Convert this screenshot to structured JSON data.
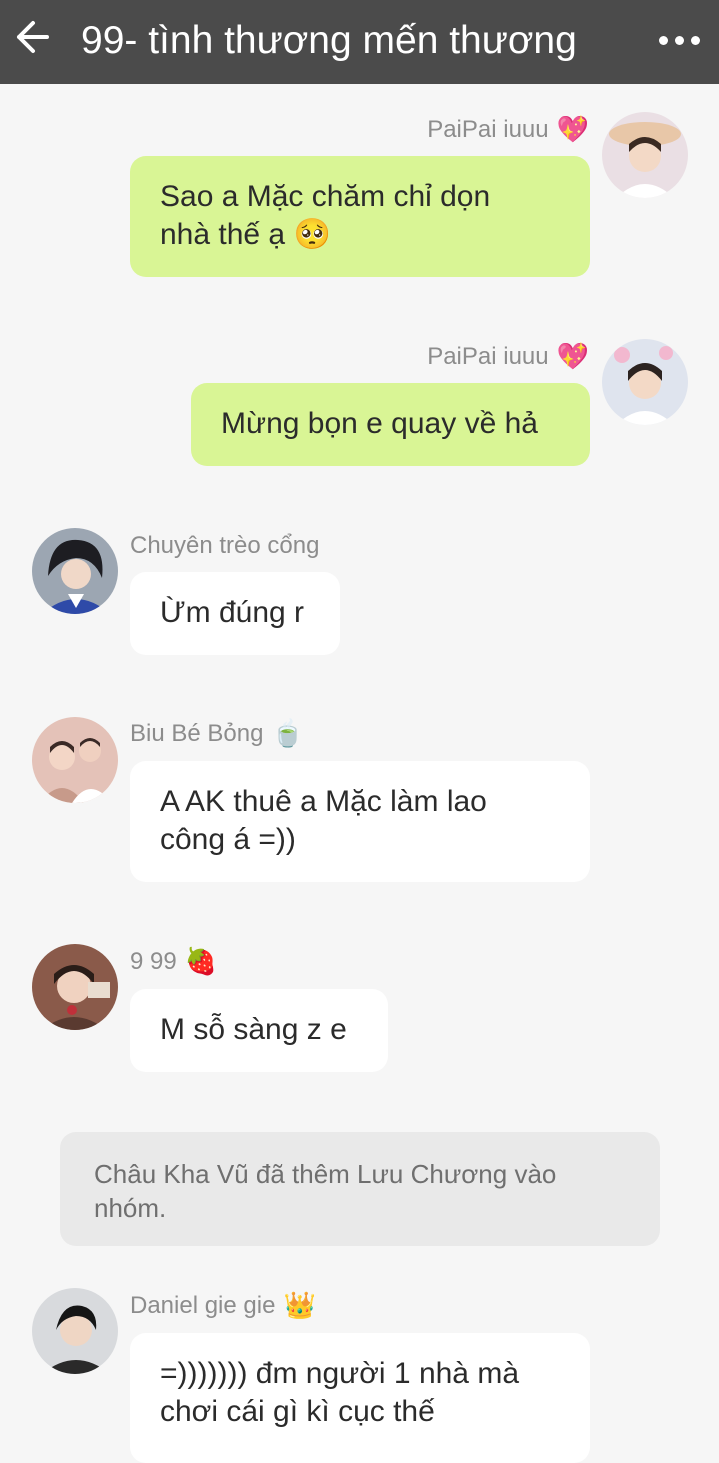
{
  "header": {
    "title": "99- tình thương mến thương",
    "back_icon": "arrow-left-icon",
    "more_icon": "more-dots-icon",
    "background": "#4b4b4b"
  },
  "colors": {
    "outgoing_bubble": "#d9f595",
    "incoming_bubble": "#ffffff",
    "background": "#f6f6f6",
    "system_notice": "#e9e9e9"
  },
  "messages": [
    {
      "direction": "out",
      "sender": "PaiPai iuuu",
      "sender_emoji": "💖",
      "text_line1": "Sao a Mặc chăm chỉ dọn",
      "text_line2": "nhà thế ạ 🥺"
    },
    {
      "direction": "out",
      "sender": "PaiPai iuuu",
      "sender_emoji": "💖",
      "text_line1": "Mừng bọn e quay về hả"
    },
    {
      "direction": "in",
      "sender": "Chuyên trèo cổng",
      "text_line1": "Ừm đúng r"
    },
    {
      "direction": "in",
      "sender": "Biu Bé Bỏng",
      "sender_emoji": "🍵",
      "text_line1": "A AK thuê a Mặc làm lao",
      "text_line2": "công á =))"
    },
    {
      "direction": "in",
      "sender": "9 99",
      "sender_emoji": "🍓",
      "text_line1": "M sỗ sàng z e"
    },
    {
      "direction": "in",
      "sender": "Daniel gie gie",
      "sender_emoji": "👑",
      "text_line1": "=))))))) đm người 1 nhà mà",
      "text_line2": "chơi cái gì kì cục thế"
    }
  ],
  "system_notice": {
    "line1": "Châu Kha Vũ đã thêm Lưu Chương vào",
    "line2": "nhóm."
  }
}
